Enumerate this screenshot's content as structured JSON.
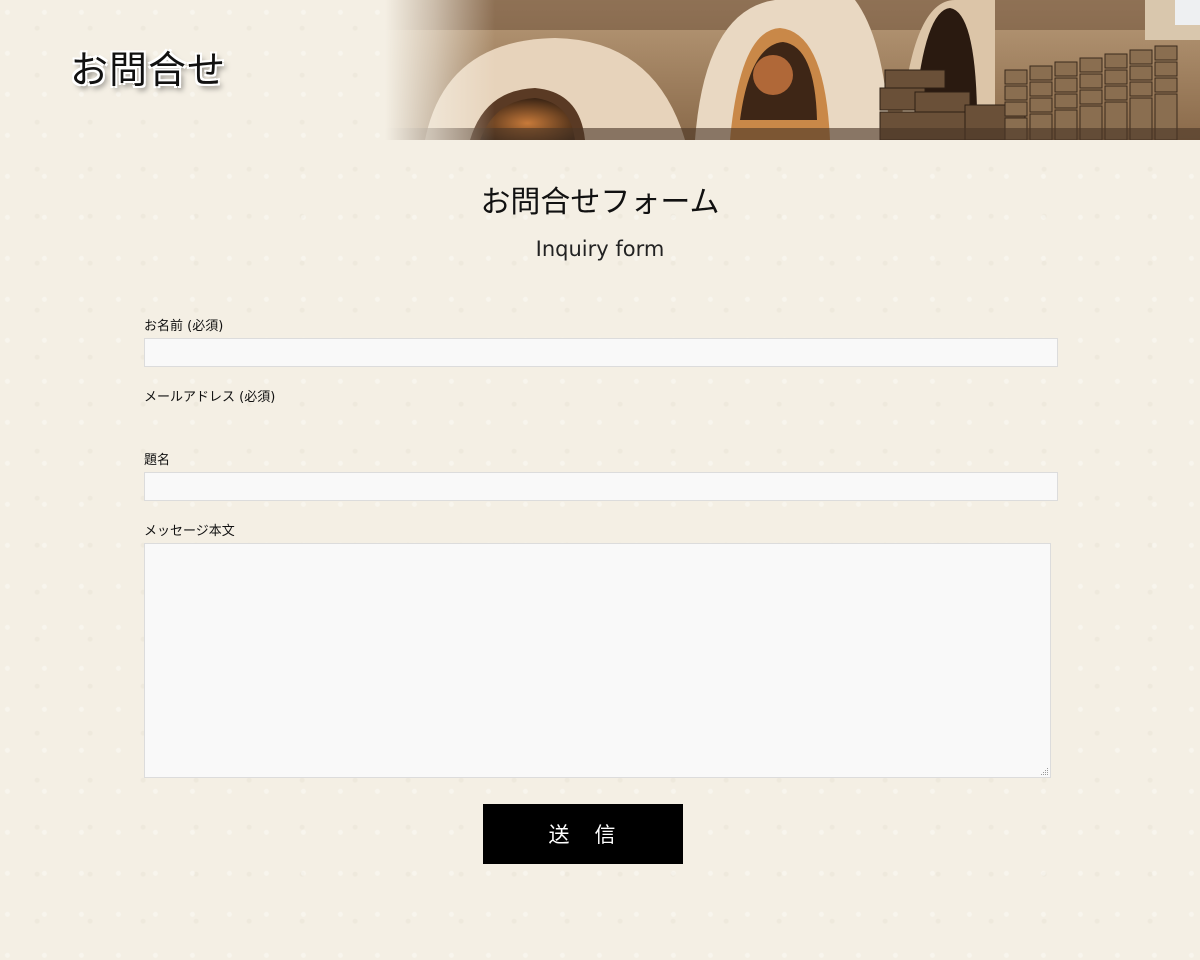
{
  "header": {
    "title": "お問合せ",
    "hero_image": "pottery-kiln-photo"
  },
  "form": {
    "heading": "お問合せフォーム",
    "subheading": "Inquiry form",
    "fields": {
      "name": {
        "label": "お名前 (必須)",
        "value": "",
        "placeholder": ""
      },
      "email": {
        "label": "メールアドレス (必須)"
      },
      "subject": {
        "label": "題名",
        "value": "",
        "placeholder": ""
      },
      "message": {
        "label": "メッセージ本文",
        "value": "",
        "placeholder": ""
      }
    },
    "submit_label": "送　信"
  },
  "colors": {
    "background": "#f4efe4",
    "input_background": "#f9f9f9",
    "input_border": "#dcdcdc",
    "button_background": "#000000",
    "button_text": "#ffffff"
  }
}
